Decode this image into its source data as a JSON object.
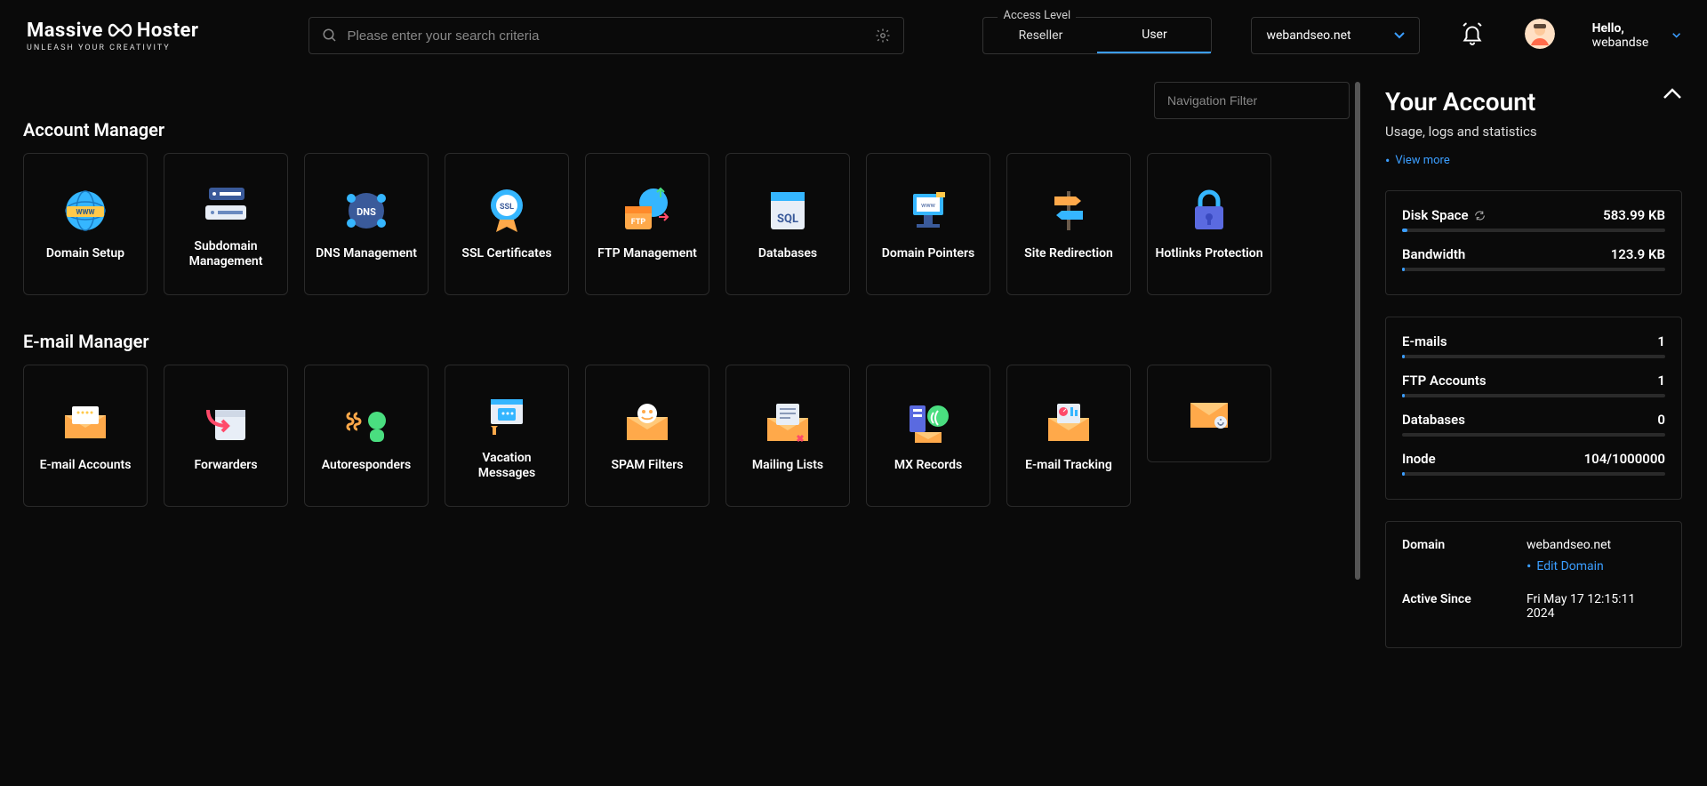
{
  "header": {
    "logo_main_left": "Massive",
    "logo_main_right": "Hoster",
    "logo_sub": "UNLEASH YOUR CREATIVITY",
    "search_placeholder": "Please enter your search criteria",
    "access_level_label": "Access Level",
    "access_tabs": {
      "reseller": "Reseller",
      "user": "User"
    },
    "domain": "webandseo.net",
    "hello_prefix": "Hello,",
    "hello_user": "webandse"
  },
  "nav_filter_placeholder": "Navigation Filter",
  "sections": {
    "account": {
      "title": "Account Manager",
      "tiles": [
        {
          "id": "domain-setup",
          "label": "Domain Setup"
        },
        {
          "id": "subdomain-management",
          "label": "Subdomain Management"
        },
        {
          "id": "dns-management",
          "label": "DNS Management"
        },
        {
          "id": "ssl-certificates",
          "label": "SSL Certificates"
        },
        {
          "id": "ftp-management",
          "label": "FTP Management"
        },
        {
          "id": "databases",
          "label": "Databases"
        },
        {
          "id": "domain-pointers",
          "label": "Domain Pointers"
        },
        {
          "id": "site-redirection",
          "label": "Site Redirection"
        },
        {
          "id": "hotlinks-protection",
          "label": "Hotlinks Protection"
        }
      ]
    },
    "email": {
      "title": "E-mail Manager",
      "tiles": [
        {
          "id": "email-accounts",
          "label": "E-mail Accounts"
        },
        {
          "id": "forwarders",
          "label": "Forwarders"
        },
        {
          "id": "autoresponders",
          "label": "Autoresponders"
        },
        {
          "id": "vacation-messages",
          "label": "Vacation Messages"
        },
        {
          "id": "spam-filters",
          "label": "SPAM Filters"
        },
        {
          "id": "mailing-lists",
          "label": "Mailing Lists"
        },
        {
          "id": "mx-records",
          "label": "MX Records"
        },
        {
          "id": "email-tracking",
          "label": "E-mail Tracking"
        },
        {
          "id": "email-extra",
          "label": ""
        }
      ]
    }
  },
  "right": {
    "title": "Your Account",
    "subtitle": "Usage, logs and statistics",
    "view_more": "View more",
    "stats1": [
      {
        "name": "Disk Space",
        "value": "583.99 KB",
        "refresh": true,
        "fill": 2
      },
      {
        "name": "Bandwidth",
        "value": "123.9 KB",
        "fill": 1
      }
    ],
    "stats2": [
      {
        "name": "E-mails",
        "value": "1",
        "fill": 1
      },
      {
        "name": "FTP Accounts",
        "value": "1",
        "fill": 1
      },
      {
        "name": "Databases",
        "value": "0",
        "fill": 0
      },
      {
        "name": "Inode",
        "value": "104/1000000",
        "fill": 1
      }
    ],
    "info": {
      "domain_key": "Domain",
      "domain_val": "webandseo.net",
      "edit_domain": "Edit Domain",
      "active_key": "Active Since",
      "active_val": "Fri May 17 12:15:11 2024"
    }
  }
}
